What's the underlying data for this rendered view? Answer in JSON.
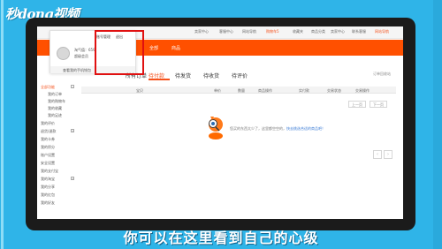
{
  "logo": {
    "text": "秒dong视频"
  },
  "topbar": {
    "links": [
      "卖家中心",
      "客服中心",
      "网站导航",
      "购物车5",
      "收藏夹",
      "商品分类",
      "卖家中心",
      "联系客服",
      "网站导航"
    ]
  },
  "navbar": {
    "items": [
      "全部",
      "商品"
    ]
  },
  "user_card": {
    "tabs": [
      "账号管理",
      "退出"
    ],
    "lines": [
      "淘气值：659",
      "超级会员"
    ],
    "bottom_link": "查看我的手机钱包"
  },
  "sidebar": {
    "items": [
      "全部功能",
      "我的订单",
      "我的购物车",
      "我的收藏",
      "我的足迹",
      "我的评价",
      "退货/退款",
      "我的卡券",
      "我的积分",
      "账户设置",
      "安全设置",
      "我的支付宝",
      "我的淘宝",
      "我的分享",
      "我的红包",
      "我的好友"
    ]
  },
  "tabs": {
    "items": [
      "所有订单",
      "待付款",
      "待发货",
      "待收货",
      "待评价"
    ],
    "right": "订单回收站"
  },
  "table": {
    "headers": [
      "宝贝",
      "单价",
      "数量",
      "商品操作",
      "实付款",
      "交易状态",
      "交易操作"
    ]
  },
  "pager": {
    "prev": "上一页",
    "next": "下一页"
  },
  "empty_state": {
    "text": "您买的东西太少了，这里都空空的，",
    "link": "快去挑选合适的商品吧！"
  },
  "subtitle": "你可以在这里看到自己的心级",
  "colors": {
    "accent": "#ff5000",
    "frame_bg": "#2fb4e8",
    "highlight": "#e01010"
  }
}
